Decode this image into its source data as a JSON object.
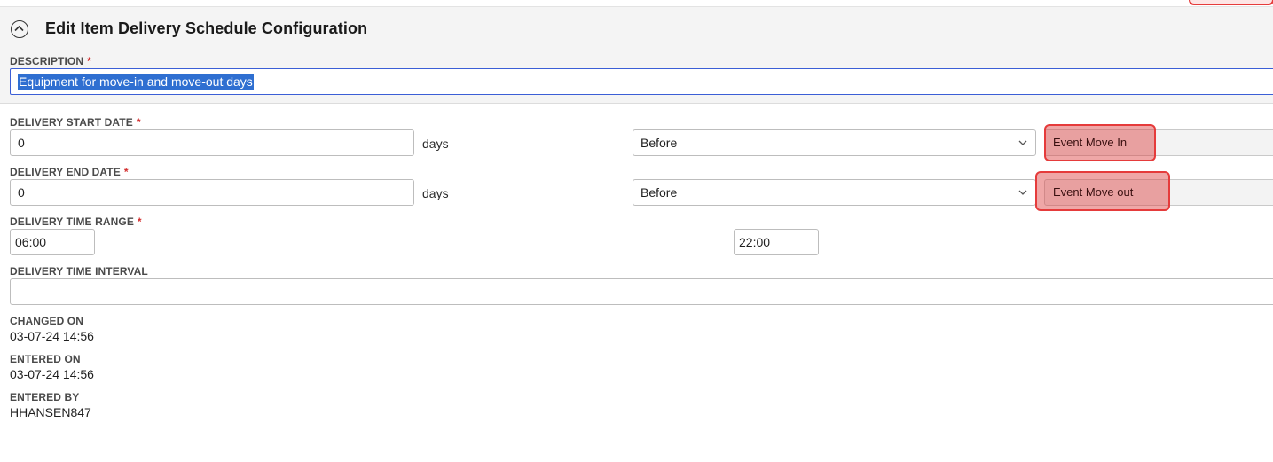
{
  "header": {
    "title": "Edit Item Delivery Schedule Configuration"
  },
  "description": {
    "label": "DESCRIPTION",
    "required_mark": "*",
    "value": "Equipment for move-in and move-out days"
  },
  "delivery_start": {
    "label": "DELIVERY START DATE",
    "required_mark": "*",
    "value": "0",
    "unit": "days",
    "relation": "Before",
    "event": "Event Move In"
  },
  "delivery_end": {
    "label": "DELIVERY END DATE",
    "required_mark": "*",
    "value": "0",
    "unit": "days",
    "relation": "Before",
    "event": "Event Move out"
  },
  "time_range": {
    "label": "DELIVERY TIME RANGE",
    "required_mark": "*",
    "start": "06:00",
    "end": "22:00"
  },
  "time_interval": {
    "label": "DELIVERY TIME INTERVAL",
    "value": ""
  },
  "meta": {
    "changed_on_label": "CHANGED ON",
    "changed_on": "03-07-24 14:56",
    "entered_on_label": "ENTERED ON",
    "entered_on": "03-07-24 14:56",
    "entered_by_label": "ENTERED BY",
    "entered_by": "HHANSEN847"
  },
  "colors": {
    "highlight_border": "#e53b3b",
    "selection": "#2f6fd1",
    "required": "#d32f2f"
  },
  "icons": {
    "collapse": "chevron-up-circle-icon",
    "dropdown": "chevron-down-icon"
  }
}
